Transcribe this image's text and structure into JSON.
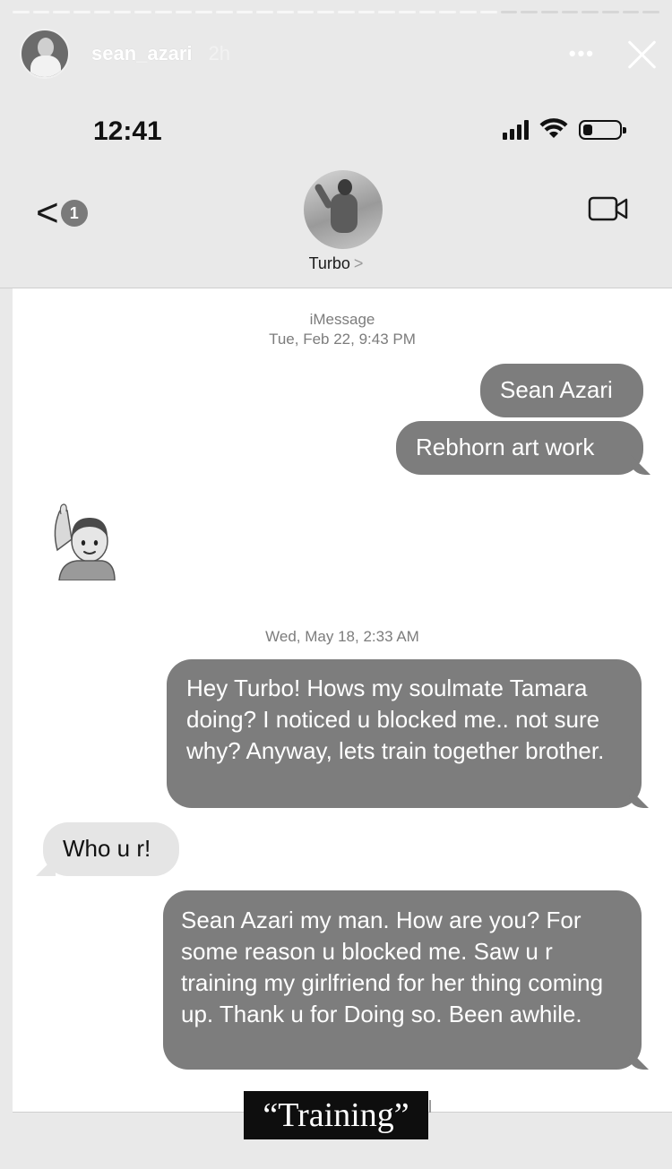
{
  "story": {
    "username": "sean_azari",
    "time_ago": "2h",
    "more_label": "•••",
    "progress_segments_total": 32,
    "progress_segments_done": 24,
    "caption": "“Training”"
  },
  "status_bar": {
    "time": "12:41",
    "battery_level": 0.25
  },
  "conversation": {
    "back_badge": "1",
    "contact_name": "Turbo",
    "contact_chevron": ">"
  },
  "messages": {
    "service_label": "iMessage",
    "timestamp_1": "Tue, Feb 22, 9:43 PM",
    "timestamp_2": "Wed, May 18, 2:33 AM",
    "items": [
      {
        "direction": "out",
        "text": "Sean Azari"
      },
      {
        "direction": "out",
        "text": "Rebhorn art work"
      },
      {
        "direction": "in",
        "text": "🙋‍♂️",
        "kind": "emoji",
        "icon": "man-raising-hand-icon"
      },
      {
        "direction": "out",
        "text": "Hey Turbo! Hows my soulmate Tamara doing? I noticed u blocked me.. not sure why? Anyway, lets train together brother."
      },
      {
        "direction": "in",
        "text": "Who u r!"
      },
      {
        "direction": "out",
        "text": "Sean Azari my man. How are you? For some reason u blocked me. Saw u r training my girlfriend for her thing coming up. Thank u for Doing so. Been awhile."
      }
    ]
  },
  "colors": {
    "outgoing_bubble": "#7d7d7d",
    "incoming_bubble": "#e5e5e5",
    "background": "#ffffff"
  }
}
